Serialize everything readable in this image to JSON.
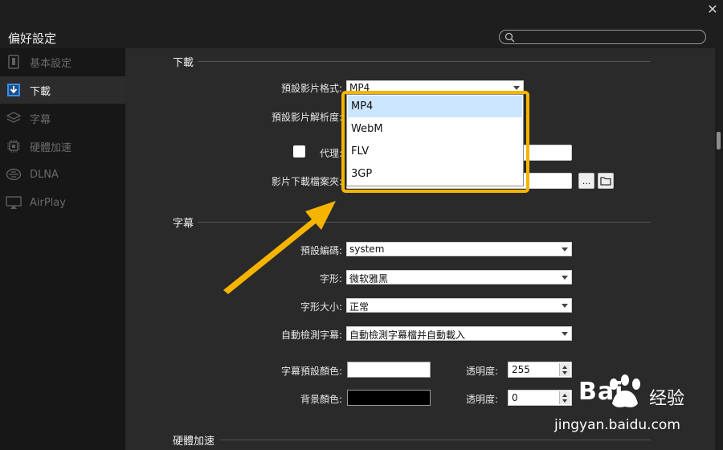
{
  "window": {
    "title": "偏好設定",
    "close_glyph": "✕"
  },
  "search": {
    "placeholder": "",
    "icon": "search-icon"
  },
  "sidebar": {
    "items": [
      {
        "label": "基本設定",
        "icon": "general-settings-icon",
        "active": false
      },
      {
        "label": "下載",
        "icon": "download-icon",
        "active": true
      },
      {
        "label": "字幕",
        "icon": "subtitle-layers-icon",
        "active": false
      },
      {
        "label": "硬體加速",
        "icon": "chip-icon",
        "active": false
      },
      {
        "label": "DLNA",
        "icon": "dlna-icon",
        "active": false
      },
      {
        "label": "AirPlay",
        "icon": "airplay-icon",
        "active": false
      }
    ]
  },
  "download": {
    "section_title": "下載",
    "format_label": "預設影片格式:",
    "format_value": "MP4",
    "resolution_label": "預設影片解析度:",
    "proxy_label": "代理:",
    "folder_label": "影片下載檔案夾:",
    "browse_label": "...",
    "folder_icon": "folder-icon",
    "format_options": [
      "MP4",
      "WebM",
      "FLV",
      "3GP"
    ],
    "selected_option": "MP4"
  },
  "subtitle": {
    "section_title": "字幕",
    "encoding_label": "預設編碼:",
    "encoding_value": "system",
    "font_label": "字形:",
    "font_value": "微软雅黑",
    "size_label": "字形大小:",
    "size_value": "正常",
    "auto_label": "自動檢測字幕:",
    "auto_value": "自動檢測字幕檔并自動載入",
    "color_label": "字幕預設顏色:",
    "color_value": "#ffffff",
    "opacity_label": "透明度:",
    "opacity_value": "255",
    "bg_label": "背景顏色:",
    "bg_value": "#000000",
    "bg_opacity_label": "透明度:",
    "bg_opacity_value": "0"
  },
  "hwaccel": {
    "section_title": "硬體加速"
  },
  "annotation": {
    "highlight_color": "#f5b400",
    "arrow_color": "#f5b400"
  },
  "watermark": {
    "brand": "Bai",
    "brand_cn": "经验",
    "url": "jingyan.baidu.com"
  }
}
